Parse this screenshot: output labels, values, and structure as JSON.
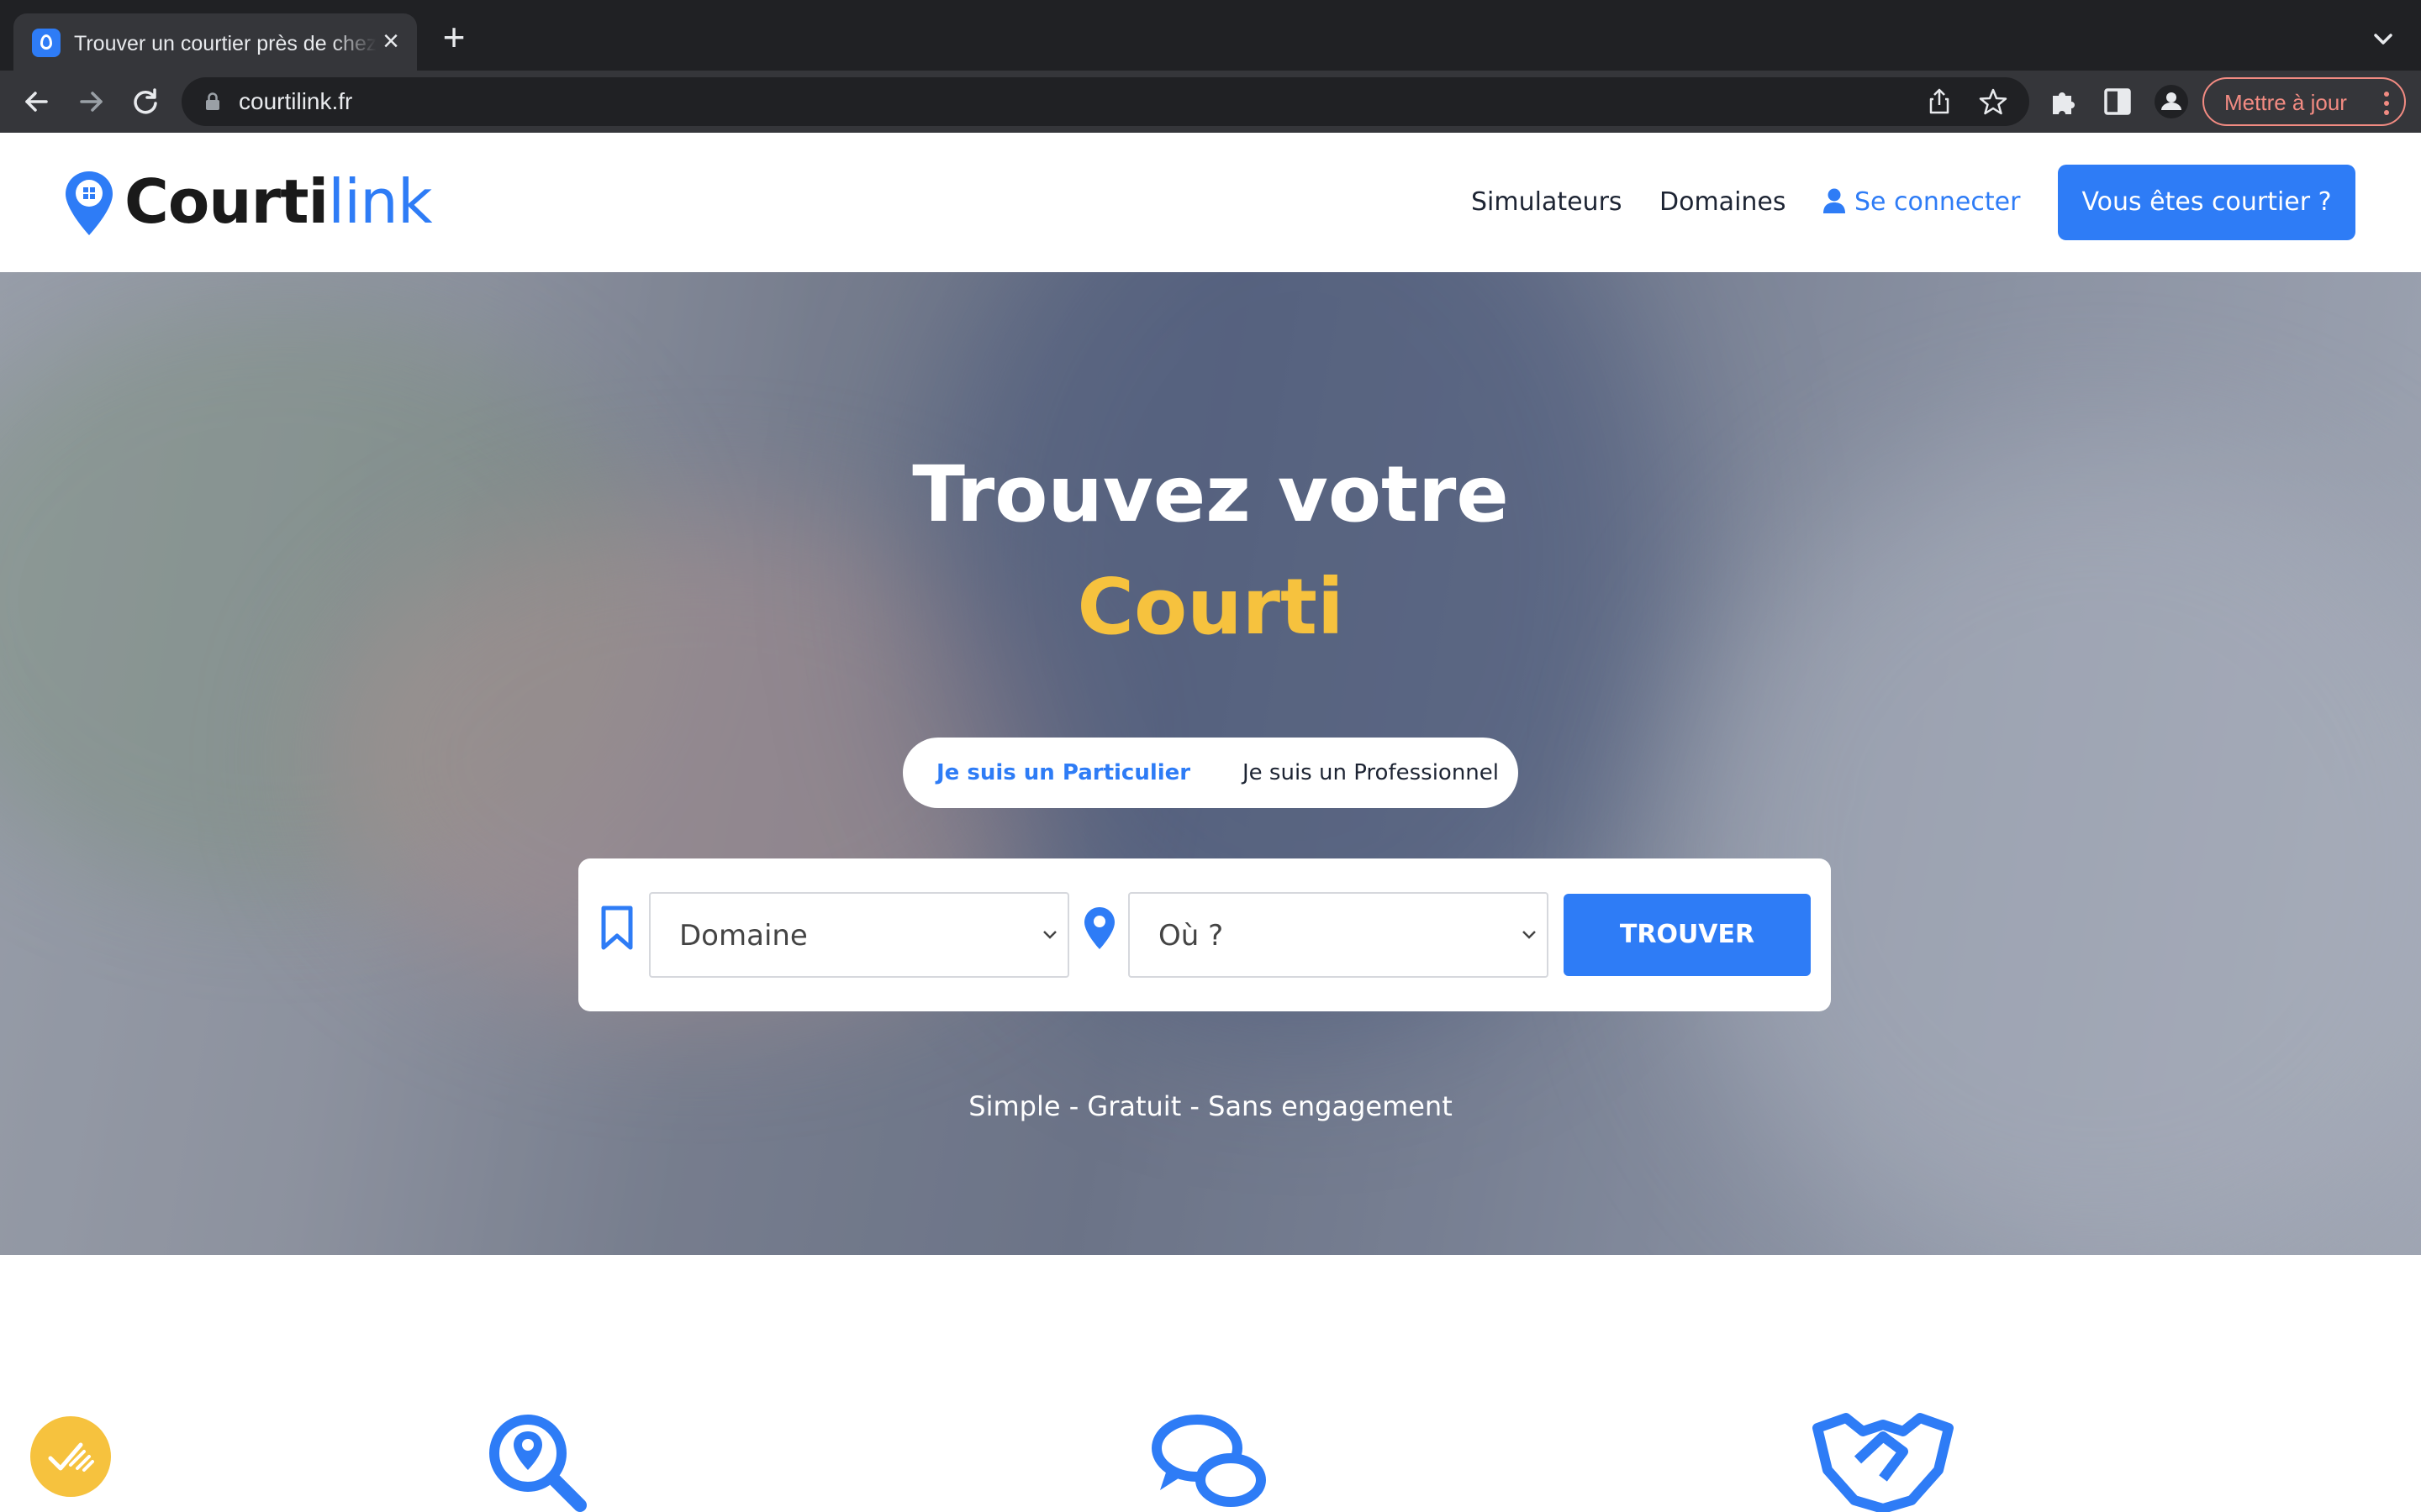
{
  "browser": {
    "tab_title": "Trouver un courtier près de chez vous",
    "url": "courtilink.fr",
    "update_label": "Mettre à jour"
  },
  "header": {
    "logo_part1": "Courti",
    "logo_part2": "link",
    "nav": [
      "Simulateurs",
      "Domaines"
    ],
    "login_label": "Se connecter",
    "cta_label": "Vous êtes courtier ?"
  },
  "hero": {
    "title": "Trouvez votre",
    "subtitle": "Courti",
    "toggle": {
      "particulier": "Je suis un Particulier",
      "professionnel": "Je suis un Professionnel"
    },
    "search": {
      "domain_label": "Domaine",
      "location_label": "Où ?",
      "button_label": "TROUVER"
    },
    "tagline": "Simple - Gratuit - Sans engagement"
  },
  "colors": {
    "brand_blue": "#2e7cf6",
    "accent_yellow": "#f6c23e"
  },
  "icons": [
    "location-search-icon",
    "chat-bubbles-icon",
    "handshake-icon",
    "accessibility-check-icon"
  ]
}
